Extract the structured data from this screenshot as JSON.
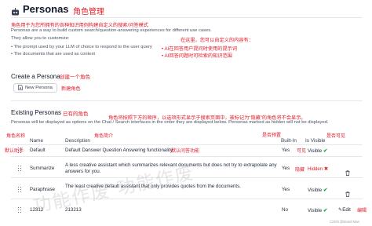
{
  "title": "Personas",
  "title_note": "角色管理",
  "intro_note": "角色用于为您所拥有的各种知识用例构建自定义的搜索/问答模式",
  "description": "Personas are a way to build custom search/question-answering experiences for different use cases.",
  "customize_label": "They allow you to customize:",
  "customize_note": "在这里，您可以自定义的内容有：",
  "customize_items": [
    "• The prompt used by your LLM of choice to respond to the user query",
    "• The documents that are used as context"
  ],
  "customize_item_notes": [
    "• AI在回答用户提问时使用的提示词",
    "• AI回答问题时可检索的知识范围"
  ],
  "create": {
    "heading": "Create a Persona",
    "heading_note": "创建一个角色",
    "button_label": "New Persona",
    "button_note": "新建角色"
  },
  "existing": {
    "heading": "Existing Personas",
    "heading_note": "已有的角色",
    "order_note": "角色将按照下方的顺序，以选项形式显示于搜索页面中，被标记为“隐藏”的角色将不会显示。",
    "description": "Personas will be displayed as options on the Chat / Search interfaces in the order they are displayed below. Personas marked as hidden will not be displayed."
  },
  "table": {
    "name_note": "角色名称",
    "description_note": "角色简介",
    "builtin_note": "是否预置",
    "visible_note": "是否可见",
    "headers": {
      "name": "Name",
      "description": "Description",
      "builtin": "Built-In",
      "visible": "Is Visible"
    },
    "rows": [
      {
        "name": "Default",
        "description": "Default Danswer Question Answering functionality.",
        "builtin": "Yes",
        "visible": "Visible",
        "name_note": "默认助手",
        "description_note": "默认问答功能",
        "visible_note": "可见"
      },
      {
        "name": "Summarize",
        "description": "A less creative assistant which summarizes relevant documents but does not try to extrapolate any answers for you.",
        "builtin": "Yes",
        "visible": "Hidden",
        "visible_note": "隐藏"
      },
      {
        "name": "Paraphrase",
        "description": "The least creative default assistant that only provides quotes from the documents.",
        "builtin": "Yes",
        "visible": "Visible"
      },
      {
        "name": "12312",
        "description": "213213",
        "builtin": "No",
        "visible": "Visible",
        "edit_label": "Edit",
        "edit_note": "编辑"
      }
    ]
  },
  "watermark": "功能作废 功能作废",
  "attribution": "CSDN @Brand-Man"
}
